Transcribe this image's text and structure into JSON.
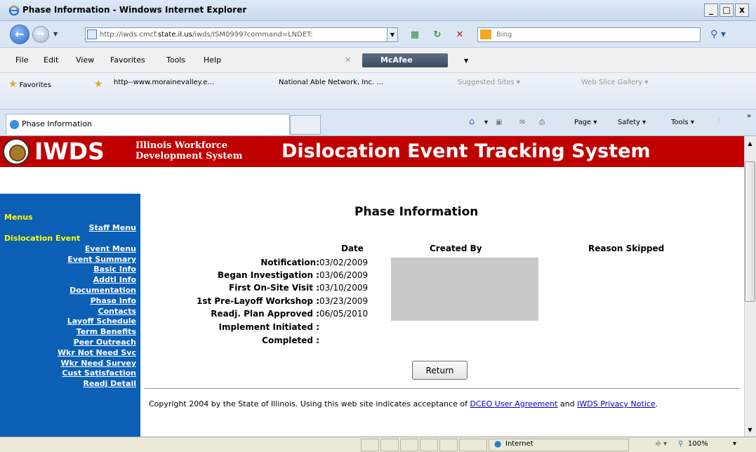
{
  "window": {
    "title": "Phase Information - Windows Internet Explorer",
    "minimize": "_",
    "maximize": "□",
    "close": "x"
  },
  "address_bar": {
    "url_prefix": "http://iwds.cmcf.",
    "url_host": "state.il.us",
    "url_suffix": "/iwds/ISM0999?command=LNDET:",
    "search_placeholder": "Bing"
  },
  "menu": {
    "items": [
      "File",
      "Edit",
      "View",
      "Favorites",
      "Tools",
      "Help"
    ],
    "mcafee": "McAfee"
  },
  "favorites": {
    "label": "Favorites",
    "items": [
      "http--www.morainevalley.e...",
      "National Able Network, Inc. ...",
      "Suggested Sites ▾",
      "Web Slice Gallery ▾"
    ]
  },
  "tab": {
    "label": "Phase Information"
  },
  "command_bar": {
    "page": "Page ▾",
    "safety": "Safety ▾",
    "tools": "Tools ▾"
  },
  "header": {
    "logo_text": "IWDS",
    "org_line1": "Illinois Workforce",
    "org_line2": "Development System",
    "system_title": "Dislocation Event Tracking System"
  },
  "sidebar": {
    "items": [
      {
        "label": "Menus",
        "style": "heading"
      },
      {
        "label": "Staff Menu",
        "style": "link"
      },
      {
        "label": "Dislocation Event",
        "style": "heading"
      },
      {
        "label": "Event Menu",
        "style": "link"
      },
      {
        "label": "Event Summary",
        "style": "link"
      },
      {
        "label": "Basic Info",
        "style": "link"
      },
      {
        "label": "Addtl Info",
        "style": "link"
      },
      {
        "label": "Documentation",
        "style": "link"
      },
      {
        "label": "Phase Info",
        "style": "link"
      },
      {
        "label": "Contacts",
        "style": "link"
      },
      {
        "label": "Layoff Schedule",
        "style": "link"
      },
      {
        "label": "Term Benefits",
        "style": "link"
      },
      {
        "label": "Peer Outreach",
        "style": "link"
      },
      {
        "label": "Wkr Not Need Svc",
        "style": "link"
      },
      {
        "label": "Wkr Need Survey",
        "style": "link"
      },
      {
        "label": "Cust Satisfaction",
        "style": "link"
      },
      {
        "label": "Readj Detail",
        "style": "link"
      }
    ]
  },
  "phase": {
    "title": "Phase Information",
    "columns": {
      "date": "Date",
      "created_by": "Created By",
      "reason_skipped": "Reason Skipped"
    },
    "rows": [
      {
        "label": "Notification:",
        "date": "03/02/2009"
      },
      {
        "label": "Began Investigation :",
        "date": "03/06/2009"
      },
      {
        "label": "First On-Site Visit :",
        "date": "03/10/2009"
      },
      {
        "label": "1st Pre-Layoff Workshop :",
        "date": "03/23/2009"
      },
      {
        "label": "Readj. Plan Approved :",
        "date": "06/05/2010"
      },
      {
        "label": "Implement Initiated :",
        "date": ""
      },
      {
        "label": "Completed :",
        "date": ""
      }
    ],
    "return_button": "Return"
  },
  "footer": {
    "copyright_text": "Copyright 2004 by the State of Illinois. Using this web site indicates acceptance of ",
    "user_agreement": "DCEO User Agreement",
    "and": " and ",
    "privacy": "IWDS Privacy Notice",
    "period": "."
  },
  "status_bar": {
    "zone": "Internet",
    "zoom": "100%"
  }
}
